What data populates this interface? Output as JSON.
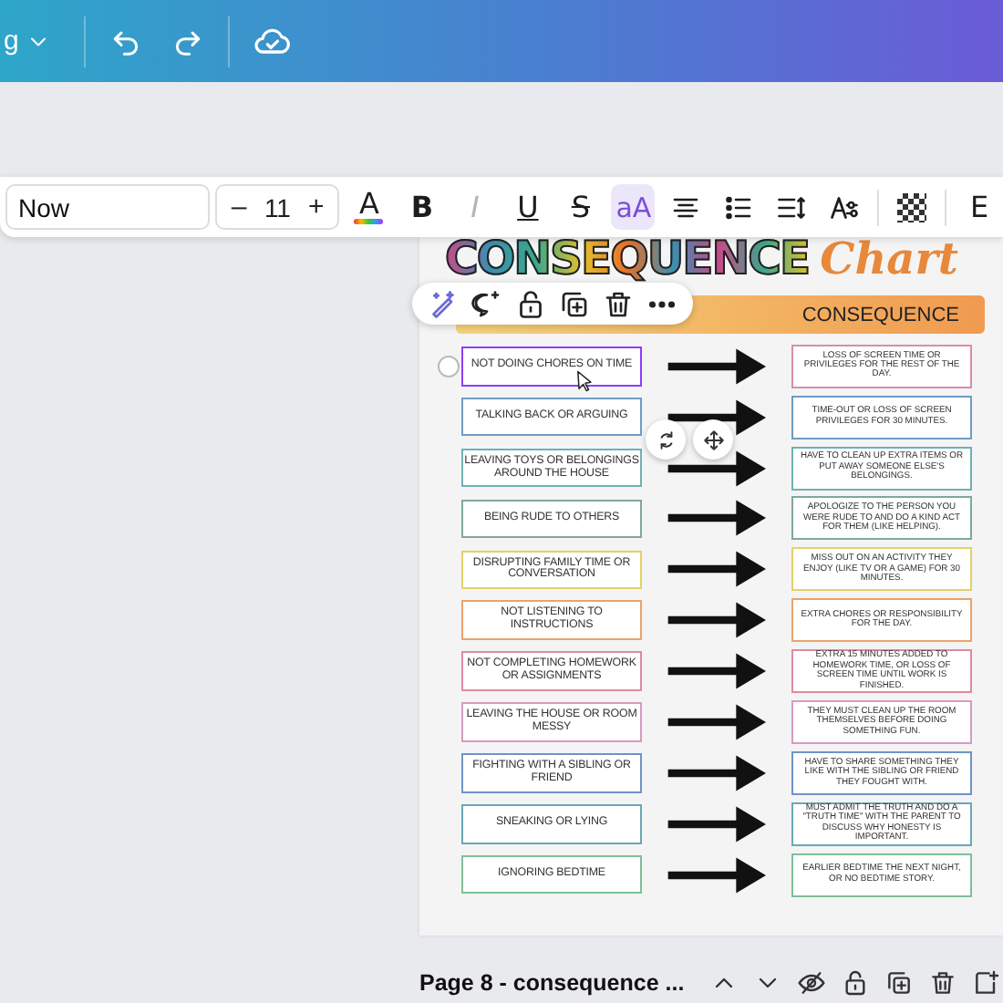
{
  "top_bar": {
    "menu_label": "g"
  },
  "text_toolbar": {
    "font": "Now",
    "size": "11",
    "decrease": "–",
    "increase": "+",
    "buttons": [
      {
        "kind": "color",
        "label": "A",
        "selected": false,
        "disabled": false
      },
      {
        "kind": "bold",
        "label": "B",
        "selected": false,
        "disabled": false
      },
      {
        "kind": "italic",
        "label": "I",
        "selected": false,
        "disabled": true
      },
      {
        "kind": "underline",
        "label": "U",
        "selected": false,
        "disabled": false
      },
      {
        "kind": "strike",
        "label": "S",
        "selected": false,
        "disabled": false
      },
      {
        "kind": "case",
        "label": "aA",
        "selected": true,
        "disabled": false
      },
      {
        "kind": "align",
        "selected": false,
        "disabled": false
      },
      {
        "kind": "list",
        "selected": false,
        "disabled": false
      },
      {
        "kind": "spacing",
        "selected": false,
        "disabled": false
      },
      {
        "kind": "effects",
        "selected": false,
        "disabled": false
      },
      {
        "kind": "transparency",
        "selected": false,
        "disabled": false
      }
    ],
    "more_label": "E"
  },
  "chart": {
    "title": "CONSEQUENCE",
    "title_script": "Chart",
    "column_header": "CONSEQUENCE",
    "rows": [
      {
        "behavior": "NOT DOING CHORES ON TIME",
        "consequence": "LOSS OF SCREEN TIME OR PRIVILEGES FOR THE REST OF THE DAY.",
        "color": "#d98cb0",
        "selected": true
      },
      {
        "behavior": "TALKING BACK OR ARGUING",
        "consequence": "TIME-OUT OR LOSS OF SCREEN PRIVILEGES FOR 30 MINUTES.",
        "color": "#6f9cc4",
        "selected": false
      },
      {
        "behavior": "LEAVING TOYS OR BELONGINGS AROUND THE HOUSE",
        "consequence": "HAVE TO CLEAN UP EXTRA ITEMS OR PUT AWAY SOMEONE ELSE'S BELONGINGS.",
        "color": "#6fb1b4",
        "selected": false
      },
      {
        "behavior": "BEING RUDE TO OTHERS",
        "consequence": "APOLOGIZE TO THE PERSON YOU WERE RUDE TO AND DO A KIND ACT FOR THEM (LIKE HELPING).",
        "color": "#7fa8a0",
        "selected": false
      },
      {
        "behavior": "DISRUPTING FAMILY TIME OR CONVERSATION",
        "consequence": "MISS OUT ON AN ACTIVITY THEY ENJOY (LIKE TV OR A GAME) FOR 30 MINUTES.",
        "color": "#e2d266",
        "selected": false
      },
      {
        "behavior": "NOT LISTENING TO INSTRUCTIONS",
        "consequence": "EXTRA CHORES OR RESPONSIBILITY FOR THE DAY.",
        "color": "#eba36a",
        "selected": false
      },
      {
        "behavior": "NOT COMPLETING HOMEWORK OR ASSIGNMENTS",
        "consequence": "EXTRA 15 MINUTES ADDED TO HOMEWORK TIME, OR LOSS OF SCREEN TIME UNTIL WORK IS FINISHED.",
        "color": "#e08aa0",
        "selected": false
      },
      {
        "behavior": "LEAVING THE HOUSE OR ROOM MESSY",
        "consequence": "THEY MUST CLEAN UP THE ROOM THEMSELVES BEFORE DOING SOMETHING FUN.",
        "color": "#d79ac0",
        "selected": false
      },
      {
        "behavior": "FIGHTING WITH A SIBLING OR FRIEND",
        "consequence": "HAVE TO SHARE SOMETHING THEY LIKE WITH THE SIBLING OR FRIEND THEY FOUGHT WITH.",
        "color": "#6f93c7",
        "selected": false
      },
      {
        "behavior": "SNEAKING OR LYING",
        "consequence": "MUST ADMIT THE TRUTH AND DO A \"TRUTH TIME\" WITH THE PARENT TO DISCUSS WHY HONESTY IS IMPORTANT.",
        "color": "#6aa7b8",
        "selected": false
      },
      {
        "behavior": "IGNORING BEDTIME",
        "consequence": "EARLIER BEDTIME THE NEXT NIGHT, OR NO BEDTIME STORY.",
        "color": "#7fbf9a",
        "selected": false
      }
    ]
  },
  "footer": {
    "page_label": "Page 8 - consequence ..."
  }
}
